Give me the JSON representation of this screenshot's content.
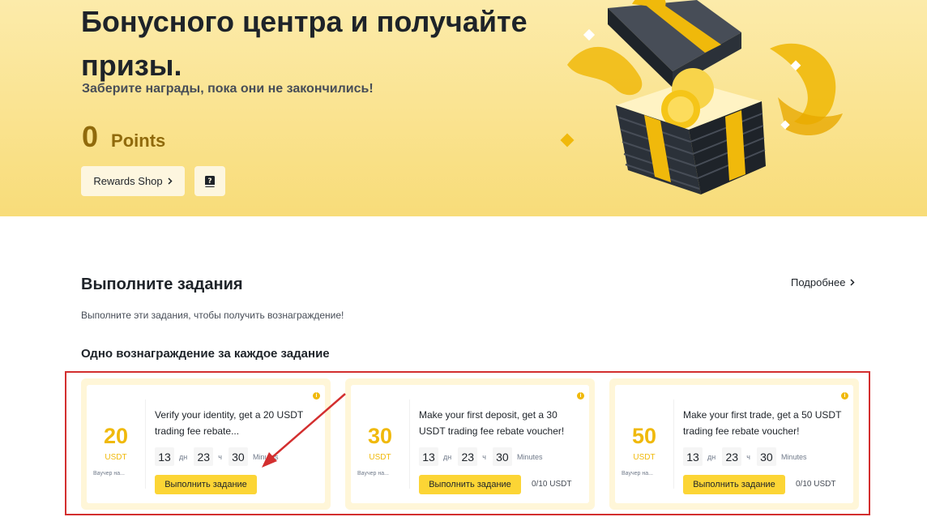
{
  "hero": {
    "title": "Бонусного центра и получайте призы.",
    "subtitle": "Заберите награды, пока они не закончились!",
    "points_value": "0",
    "points_label": "Points",
    "rewards_shop_label": "Rewards Shop",
    "colors": {
      "background": "#f8dc79",
      "points": "#906a0c"
    }
  },
  "tasks_section": {
    "title": "Выполните задания",
    "more_label": "Подробнее",
    "description": "Выполните эти задания, чтобы получить вознаграждение!",
    "subtitle": "Одно вознаграждение за каждое задание",
    "cards": [
      {
        "amount": "20",
        "unit": "USDT",
        "type_label": "Ваучер на...",
        "title": "Verify your identity, get a 20 USDT trading fee rebate...",
        "timer": {
          "days": "13",
          "days_unit": "дн",
          "hours": "23",
          "hours_unit": "ч",
          "minutes": "30",
          "minutes_unit": "Minutes"
        },
        "button_label": "Выполнить задание",
        "progress": ""
      },
      {
        "amount": "30",
        "unit": "USDT",
        "type_label": "Ваучер на...",
        "title": "Make your first deposit, get a 30 USDT trading fee rebate voucher!",
        "timer": {
          "days": "13",
          "days_unit": "дн",
          "hours": "23",
          "hours_unit": "ч",
          "minutes": "30",
          "minutes_unit": "Minutes"
        },
        "button_label": "Выполнить задание",
        "progress": "0/10 USDT"
      },
      {
        "amount": "50",
        "unit": "USDT",
        "type_label": "Ваучер на...",
        "title": "Make your first trade, get a 50 USDT trading fee rebate voucher!",
        "timer": {
          "days": "13",
          "days_unit": "дн",
          "hours": "23",
          "hours_unit": "ч",
          "minutes": "30",
          "minutes_unit": "Minutes"
        },
        "button_label": "Выполнить задание",
        "progress": "0/10 USDT"
      }
    ],
    "colors": {
      "accent": "#f0b90b",
      "button": "#fcd535",
      "highlight_frame": "#d32f2f"
    }
  },
  "icons": [
    "chevron-right-icon",
    "help-book-icon",
    "info-icon",
    "gift-box-illustration",
    "annotation-arrow"
  ]
}
